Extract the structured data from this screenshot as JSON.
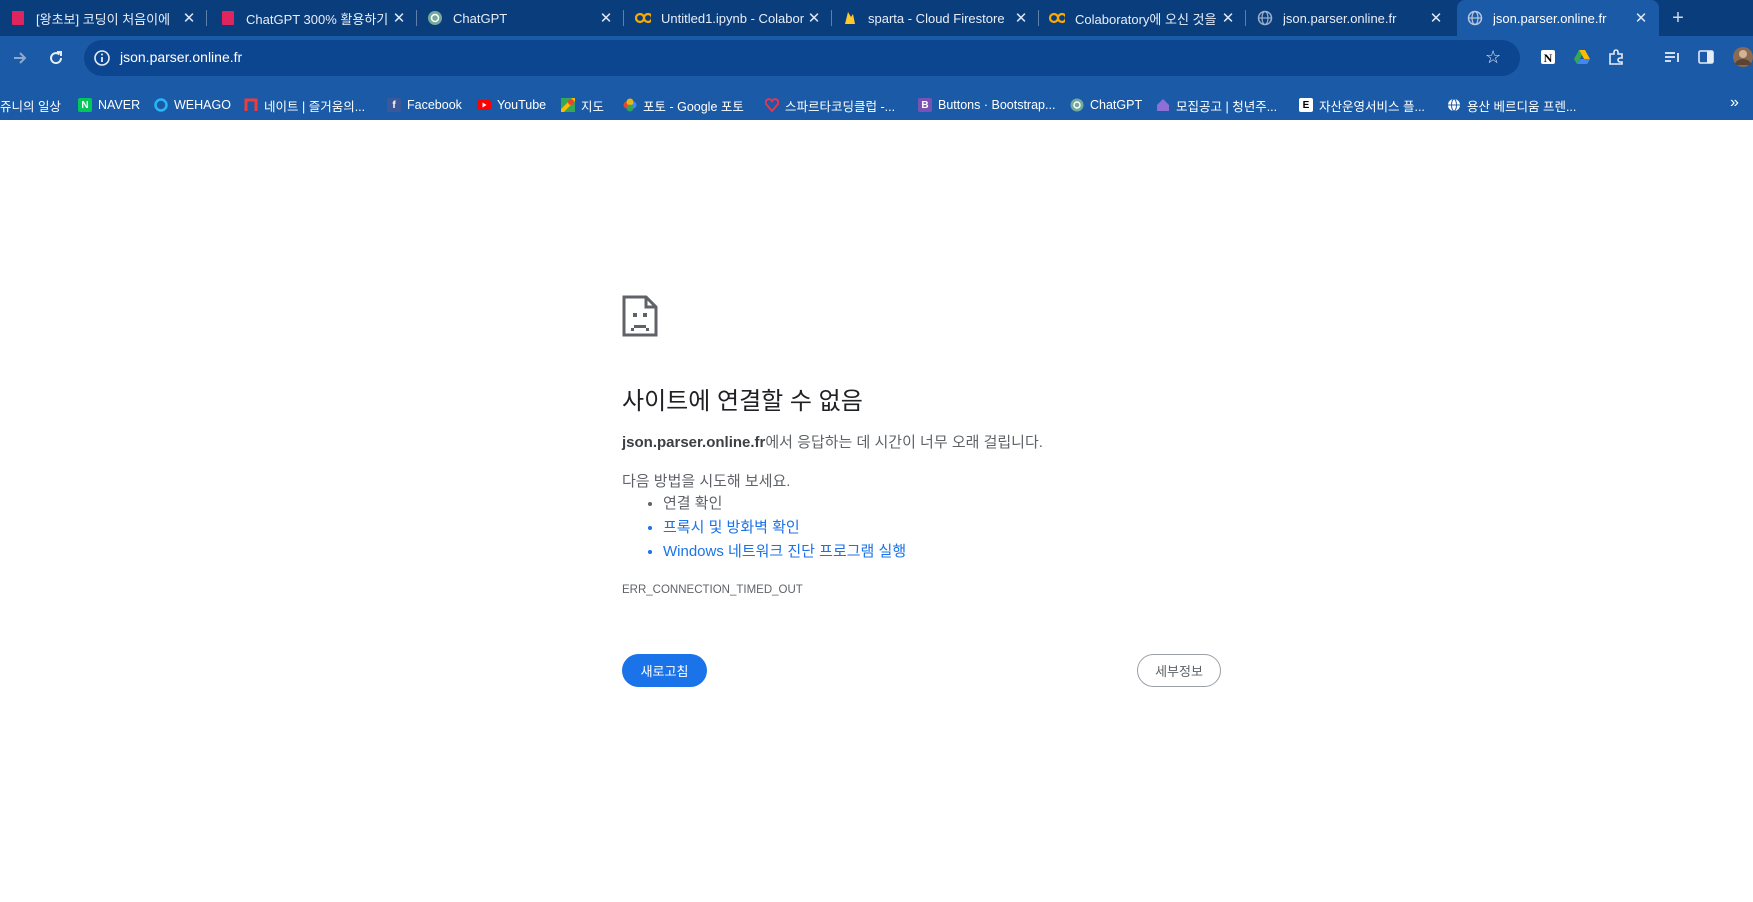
{
  "colors": {
    "tab_strip": "#0a3d7c",
    "toolbar": "#1a5aa6",
    "omnibox": "#0d4690",
    "primary_button": "#1a73e8",
    "link": "#1a73e8"
  },
  "tabs": [
    {
      "title": "[왕초보] 코딩이 처음이에",
      "icon": "book-icon"
    },
    {
      "title": "ChatGPT 300% 활용하기",
      "icon": "book-icon"
    },
    {
      "title": "ChatGPT",
      "icon": "chatgpt-icon"
    },
    {
      "title": "Untitled1.ipynb - Colabor",
      "icon": "colab-icon"
    },
    {
      "title": "sparta - Cloud Firestore",
      "icon": "firebase-icon"
    },
    {
      "title": "Colaboratory에 오신 것을",
      "icon": "colab-icon"
    },
    {
      "title": "json.parser.online.fr",
      "icon": "globe-icon"
    },
    {
      "title": "json.parser.online.fr",
      "icon": "globe-icon",
      "active": true
    }
  ],
  "toolbar": {
    "url": "json.parser.online.fr"
  },
  "bookmarks": [
    {
      "label": "쥬니의 일상",
      "icon": "none"
    },
    {
      "label": "NAVER",
      "icon": "naver-icon"
    },
    {
      "label": "WEHAGO",
      "icon": "wehago-icon"
    },
    {
      "label": "네이트 | 즐거움의...",
      "icon": "nate-icon"
    },
    {
      "label": "Facebook",
      "icon": "facebook-icon"
    },
    {
      "label": "YouTube",
      "icon": "youtube-icon"
    },
    {
      "label": "지도",
      "icon": "maps-icon"
    },
    {
      "label": "포토 - Google 포토",
      "icon": "google-photos-icon"
    },
    {
      "label": "스파르타코딩클럽 -...",
      "icon": "sparta-icon"
    },
    {
      "label": "Buttons · Bootstrap...",
      "icon": "bootstrap-icon"
    },
    {
      "label": "ChatGPT",
      "icon": "chatgpt-icon"
    },
    {
      "label": "모집공고 | 청년주...",
      "icon": "house-icon"
    },
    {
      "label": "자산운영서비스 플...",
      "icon": "e-icon"
    },
    {
      "label": "용산 베르디움 프렌...",
      "icon": "globe-icon"
    }
  ],
  "error": {
    "title": "사이트에 연결할 수 없음",
    "host": "json.parser.online.fr",
    "desc_suffix": "에서 응답하는 데 시간이 너무 오래 걸립니다.",
    "try_label": "다음 방법을 시도해 보세요.",
    "suggestions": [
      "연결 확인",
      "프록시 및 방화벽 확인",
      "Windows 네트워크 진단 프로그램 실행"
    ],
    "code": "ERR_CONNECTION_TIMED_OUT",
    "reload_label": "새로고침",
    "details_label": "세부정보"
  }
}
